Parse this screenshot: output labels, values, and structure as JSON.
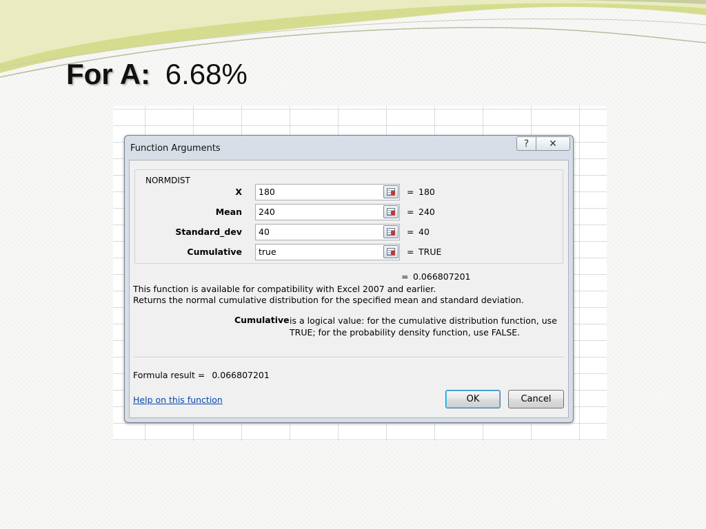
{
  "slide": {
    "title_label": "For A:",
    "title_value": "6.68%"
  },
  "dialog": {
    "title": "Function Arguments",
    "help_button": "?",
    "close_button": "✕",
    "function_name": "NORMDIST",
    "arguments": [
      {
        "label": "X",
        "value": "180",
        "result": "180"
      },
      {
        "label": "Mean",
        "value": "240",
        "result": "240"
      },
      {
        "label": "Standard_dev",
        "value": "40",
        "result": "40"
      },
      {
        "label": "Cumulative",
        "value": "true",
        "result": "TRUE"
      }
    ],
    "equals": "=",
    "function_result": "0.066807201",
    "description_line1": "This function is available for compatibility with Excel 2007 and earlier.",
    "description_line2": "Returns the normal cumulative distribution for the specified mean and standard deviation.",
    "argument_help_name": "Cumulative",
    "argument_help_text": "is a logical value: for the cumulative distribution function, use TRUE; for the probability density function, use FALSE.",
    "formula_result_label": "Formula result =",
    "formula_result_value": "0.066807201",
    "help_link": "Help on this function",
    "ok_label": "OK",
    "cancel_label": "Cancel"
  },
  "colors": {
    "title_bar": "#d7dee7",
    "link": "#0645ad",
    "swoosh_green": "#d6dc8e"
  }
}
